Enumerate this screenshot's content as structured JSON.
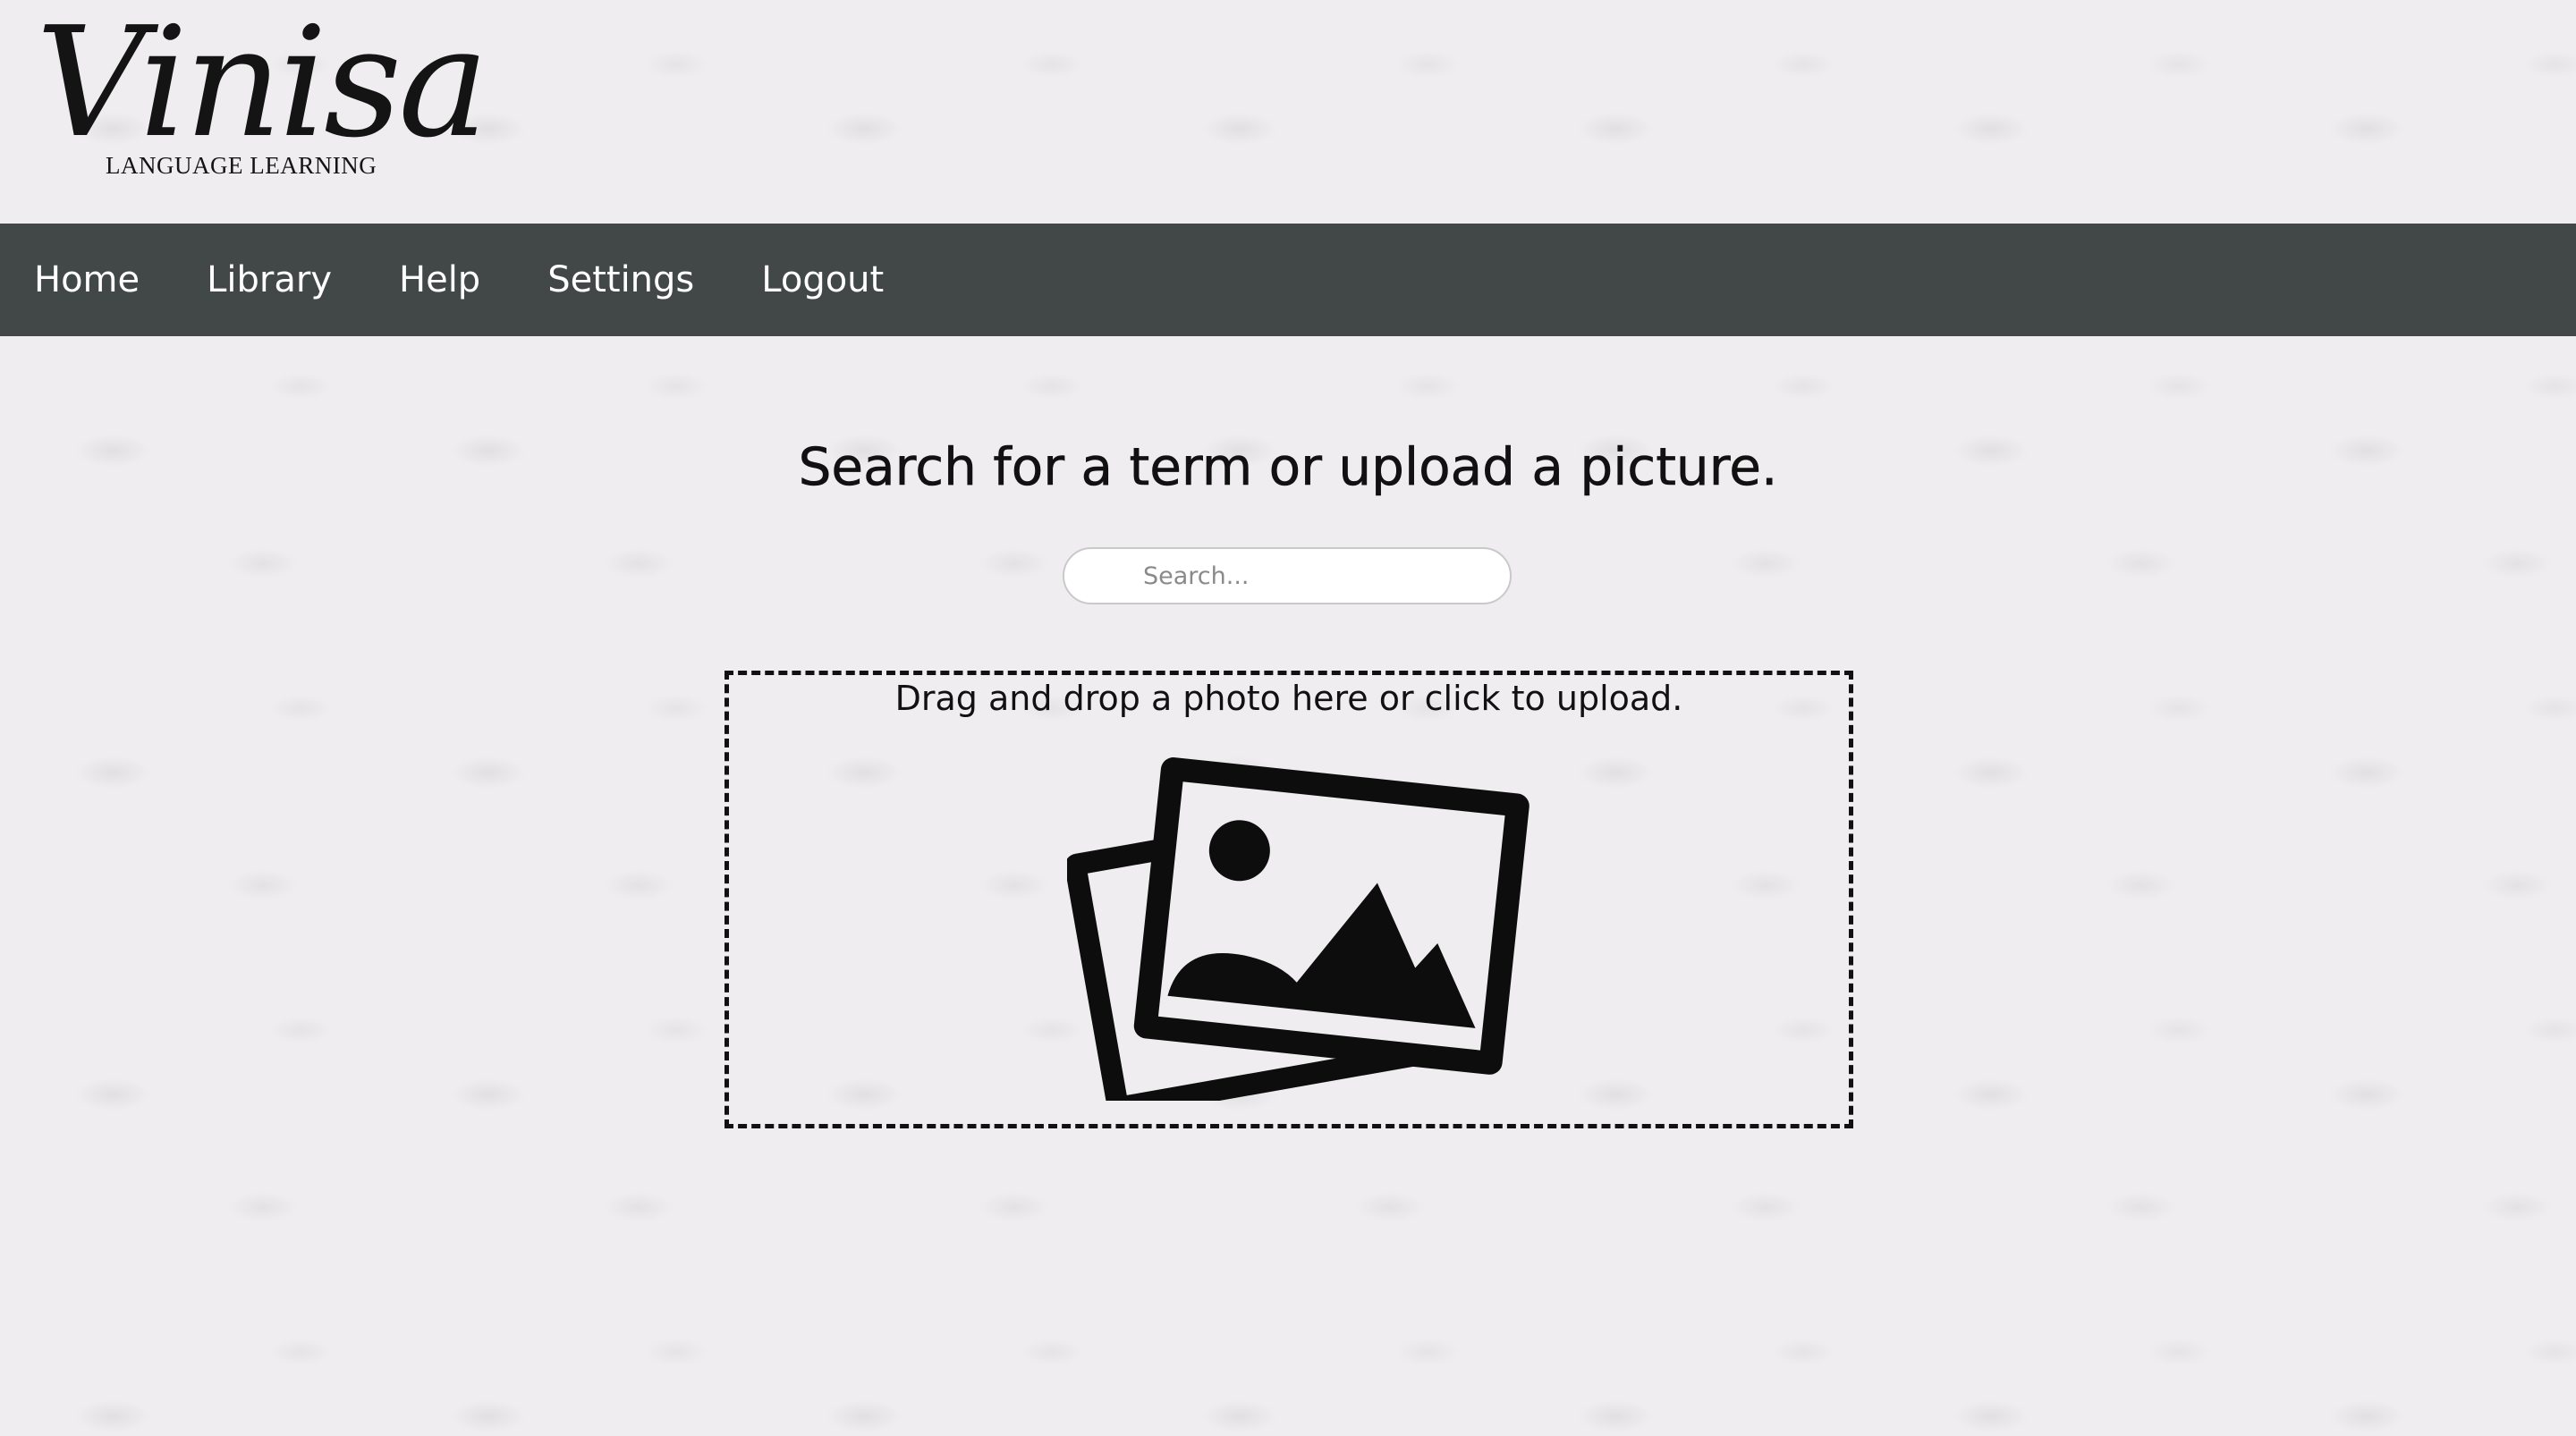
{
  "brand": {
    "name": "Vinisa",
    "tagline": "LANGUAGE LEARNING"
  },
  "nav": {
    "items": [
      {
        "label": "Home"
      },
      {
        "label": "Library"
      },
      {
        "label": "Help"
      },
      {
        "label": "Settings"
      },
      {
        "label": "Logout"
      }
    ]
  },
  "main": {
    "title": "Search for a term or upload a picture.",
    "search": {
      "placeholder": "Search...",
      "value": ""
    },
    "dropzone": {
      "text": "Drag and drop a photo here or click to upload.",
      "icon": "photos-icon"
    }
  },
  "colors": {
    "navbar": "#424848",
    "background": "#efedef",
    "text": "#111111"
  }
}
